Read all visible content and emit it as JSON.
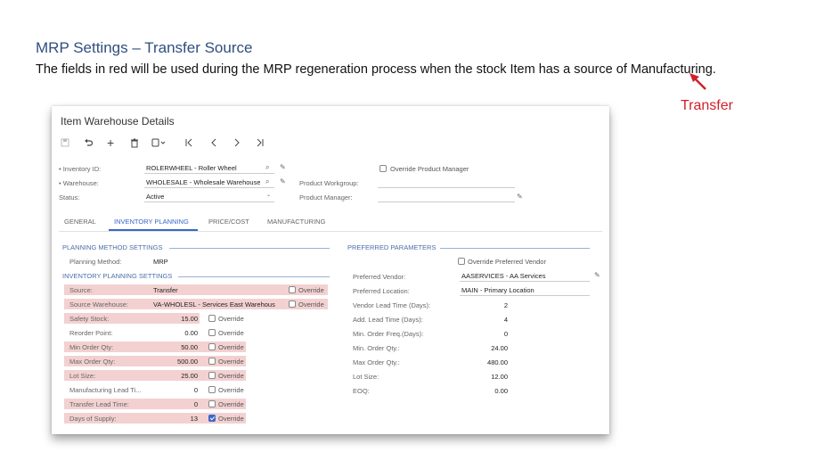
{
  "doc": {
    "title": "MRP Settings – Transfer Source",
    "body": "The fields in red will be used during the MRP regeneration process when the stock Item has a source of Manufacturing.",
    "annotation": "Transfer"
  },
  "window": {
    "title": "Item Warehouse Details"
  },
  "header": {
    "inventory_id_label": "• Inventory ID:",
    "inventory_id_value": "ROLERWHEEL - Roller Wheel",
    "warehouse_label": "• Warehouse:",
    "warehouse_value": "WHOLESALE - Wholesale Warehouse",
    "status_label": "Status:",
    "status_value": "Active",
    "override_pm_label": "Override Product Manager",
    "product_workgroup_label": "Product Workgroup:",
    "product_manager_label": "Product Manager:"
  },
  "tabs": [
    {
      "label": "GENERAL"
    },
    {
      "label": "INVENTORY PLANNING"
    },
    {
      "label": "PRICE/COST"
    },
    {
      "label": "MANUFACTURING"
    }
  ],
  "planning_method": {
    "section": "PLANNING METHOD SETTINGS",
    "label": "Planning Method:",
    "value": "MRP"
  },
  "inv_planning": {
    "section": "INVENTORY PLANNING SETTINGS",
    "override_label": "Override",
    "rows": [
      {
        "label": "Source:",
        "value": "Transfer",
        "checked": false
      },
      {
        "label": "Source Warehouse:",
        "value": "VA-WHOLESL - Services East Warehous",
        "checked": false
      },
      {
        "label": "Safety Stock:",
        "value": "15.00",
        "checked": false
      },
      {
        "label": "Reorder Point:",
        "value": "0.00",
        "checked": false
      },
      {
        "label": "Min Order Qty:",
        "value": "50.00",
        "checked": false
      },
      {
        "label": "Max Order Qty:",
        "value": "500.00",
        "checked": false
      },
      {
        "label": "Lot Size:",
        "value": "25.00",
        "checked": false
      },
      {
        "label": "Manufacturing Lead Ti...",
        "value": "0",
        "checked": false
      },
      {
        "label": "Transfer Lead Time:",
        "value": "0",
        "checked": false
      },
      {
        "label": "Days of Supply:",
        "value": "13",
        "checked": true
      }
    ]
  },
  "preferred": {
    "section": "PREFERRED PARAMETERS",
    "override_vendor_label": "Override Preferred Vendor",
    "rows": [
      {
        "label": "Preferred Vendor:",
        "value": "AASERVICES - AA Services"
      },
      {
        "label": "Preferred Location:",
        "value": "MAIN - Primary Location"
      },
      {
        "label": "Vendor Lead Time (Days):",
        "value": "2"
      },
      {
        "label": "Add. Lead Time (Days):",
        "value": "4"
      },
      {
        "label": "Min. Order Freq.(Days):",
        "value": "0"
      },
      {
        "label": "Min. Order Qty.:",
        "value": "24.00"
      },
      {
        "label": "Max Order Qty.:",
        "value": "480.00"
      },
      {
        "label": "Lot Size:",
        "value": "12.00"
      },
      {
        "label": "EOQ:",
        "value": "0.00"
      }
    ]
  },
  "colors": {
    "highlight": "#f3d1d1",
    "accent": "#3a67c9",
    "annotation": "#d0202c"
  }
}
